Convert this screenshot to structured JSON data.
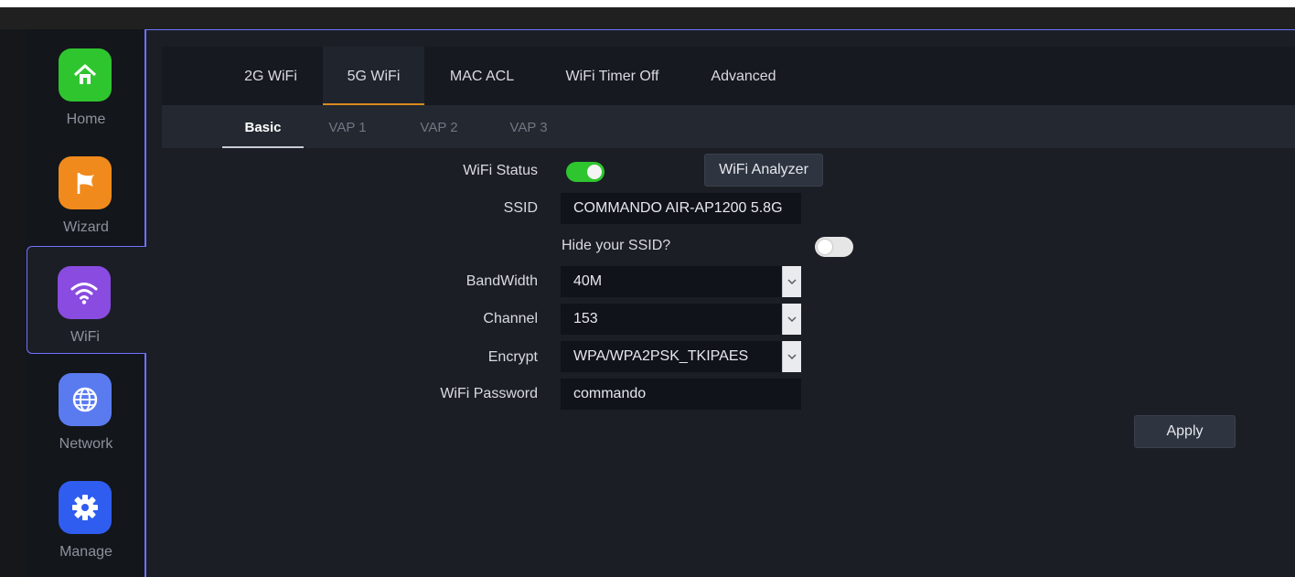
{
  "sidebar": {
    "items": [
      {
        "label": "Home",
        "color": "#2fc52f"
      },
      {
        "label": "Wizard",
        "color": "#f08a1c"
      },
      {
        "label": "WiFi",
        "color": "#8a4be0"
      },
      {
        "label": "Network",
        "color": "#5a7bf0"
      },
      {
        "label": "Manage",
        "color": "#2f5df0"
      }
    ],
    "active": "WiFi"
  },
  "tabs": {
    "items": [
      "2G WiFi",
      "5G WiFi",
      "MAC ACL",
      "WiFi Timer Off",
      "Advanced"
    ],
    "active": "5G WiFi"
  },
  "subtabs": {
    "items": [
      "Basic",
      "VAP 1",
      "VAP 2",
      "VAP 3"
    ],
    "active": "Basic"
  },
  "form": {
    "wifi_status_label": "WiFi Status",
    "wifi_status_on": true,
    "analyzer_button": "WiFi Analyzer",
    "ssid_label": "SSID",
    "ssid_value": "COMMANDO AIR-AP1200 5.8G",
    "hide_ssid_label": "Hide your SSID?",
    "hide_ssid_on": false,
    "bandwidth_label": "BandWidth",
    "bandwidth_value": "40M",
    "channel_label": "Channel",
    "channel_value": "153",
    "encrypt_label": "Encrypt",
    "encrypt_value": "WPA/WPA2PSK_TKIPAES",
    "password_label": "WiFi Password",
    "password_value": "commando",
    "apply_button": "Apply"
  },
  "colors": {
    "accent": "#6f72ff",
    "active_tab_underline": "#d98a1f",
    "toggle_on": "#2fc52f",
    "toggle_off": "#e6e6e6"
  }
}
